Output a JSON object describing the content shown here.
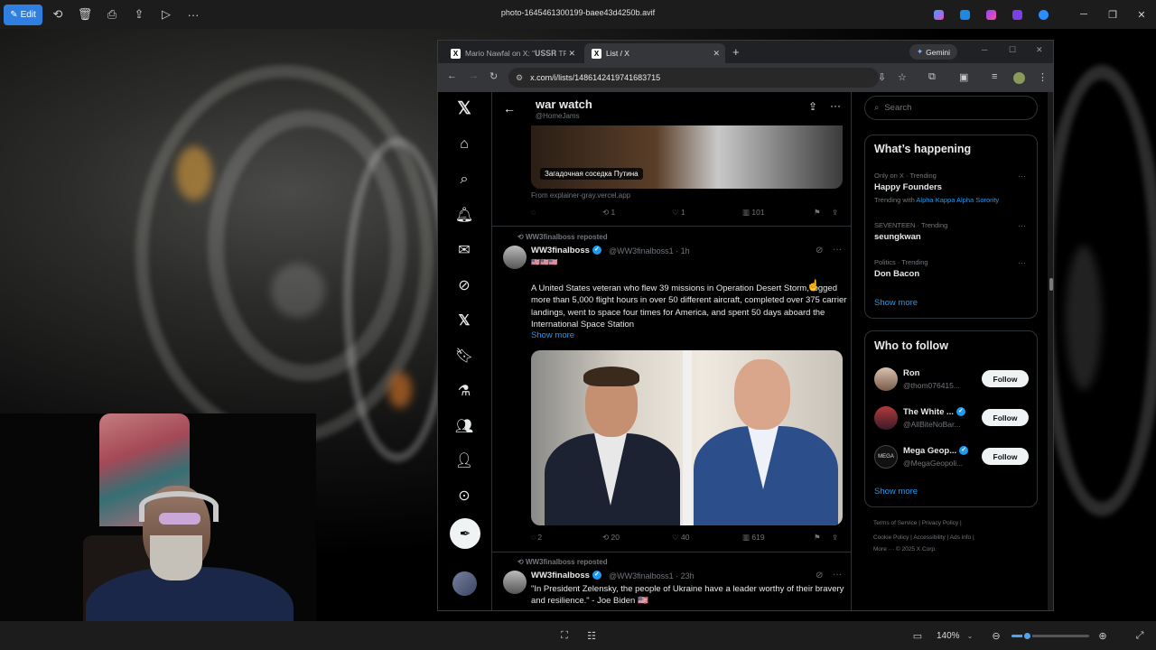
{
  "viewer": {
    "edit_label": "Edit",
    "file_title": "photo-1645461300199-baee43d4250b.avif",
    "zoom": "140%",
    "zoom_fraction": 0.2,
    "accent": "#2f7fe0"
  },
  "browser": {
    "tabs": [
      {
        "title": "Mario Nawfal on X: \"𝐔𝐒𝐒𝐑 TRUMP",
        "active": false
      },
      {
        "title": "List / X",
        "active": true
      }
    ],
    "gemini_label": "Gemini",
    "url": "x.com/i/lists/1486142419741683715"
  },
  "list": {
    "title": "war watch",
    "handle": "@HomeJams"
  },
  "tweets": [
    {
      "image_caption": "Загадочная соседка Путина",
      "from_link": "From explainer-gray.vercel.app",
      "replies": "",
      "reposts": "1",
      "likes": "1",
      "views": "101"
    },
    {
      "repost_line": "WW3finalboss reposted",
      "name": "WW3finalboss",
      "handle_time": "@WW3finalboss1 · 1h",
      "flags": "🇺🇸🇺🇸🇺🇸",
      "body": "A United States veteran who flew 39 missions in Operation Desert Storm, logged more than 5,000 flight hours in over 50 different aircraft, completed over 375 carrier landings, went to space four times for America, and spent 50 days aboard the International Space Station",
      "show_more": "Show more",
      "replies": "2",
      "reposts": "20",
      "likes": "40",
      "views": "619"
    },
    {
      "repost_line": "WW3finalboss reposted",
      "name": "WW3finalboss",
      "handle_time": "@WW3finalboss1 · 23h",
      "body": "\"In President Zelensky, the people of Ukraine have a leader worthy of their bravery and resilience.\" - Joe Biden 🇺🇸"
    }
  ],
  "sidebar": {
    "search_placeholder": "Search",
    "happening": {
      "title": "What’s happening",
      "items": [
        {
          "meta": "Only on X · Trending",
          "name": "Happy Founders",
          "with_label": "Trending with",
          "with_link": "Alpha Kappa Alpha Sorority"
        },
        {
          "meta": "SEVENTEEN · Trending",
          "name": "seungkwan"
        },
        {
          "meta": "Politics · Trending",
          "name": "Don Bacon"
        }
      ],
      "show_more": "Show more"
    },
    "who_to_follow": {
      "title": "Who to follow",
      "items": [
        {
          "name": "Ron",
          "handle": "@thom076415...",
          "follow": "Follow"
        },
        {
          "name": "The White ...",
          "handle": "@AllBiteNoBar...",
          "follow": "Follow"
        },
        {
          "name": "Mega Geop...",
          "handle": "@MegaGeopoli...",
          "follow": "Follow"
        }
      ],
      "show_more": "Show more"
    },
    "footer": {
      "row1": "Terms of Service  |  Privacy Policy  |",
      "row2": "Cookie Policy  |  Accessibility  |  Ads info  |",
      "row3": "More ···  © 2025 X Corp."
    }
  }
}
